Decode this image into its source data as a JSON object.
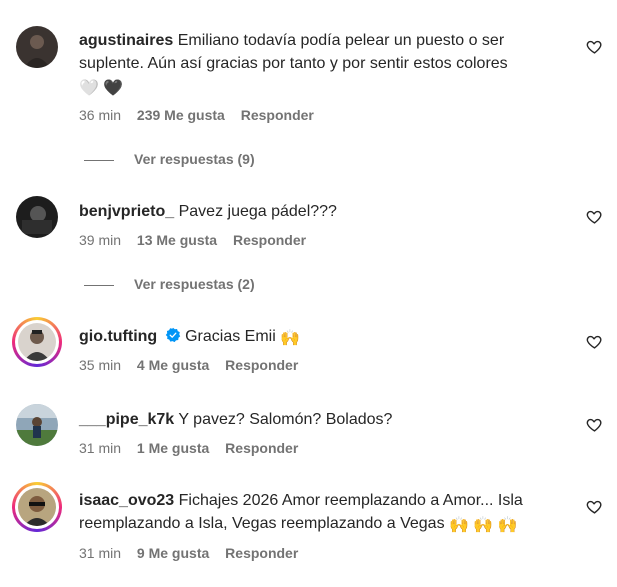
{
  "comments": [
    {
      "username": "agustinaires",
      "text": "Emiliano todavía podía pelear un puesto o ser suplente. Aún así gracias por tanto y por sentir estos colores",
      "emojis": "🤍 🖤",
      "time": "36 min",
      "likes": "239 Me gusta",
      "reply": "Responder",
      "replies": "Ver respuestas (9)"
    },
    {
      "username": "benjvprieto_",
      "text": "Pavez juega pádel???",
      "time": "39 min",
      "likes": "13 Me gusta",
      "reply": "Responder",
      "replies": "Ver respuestas (2)"
    },
    {
      "username": "gio.tufting",
      "text": "Gracias Emii",
      "emojis": "🙌",
      "time": "35 min",
      "likes": "4 Me gusta",
      "reply": "Responder"
    },
    {
      "username": "___pipe_k7k",
      "text": "Y pavez? Salomón? Bolados?",
      "time": "31 min",
      "likes": "1 Me gusta",
      "reply": "Responder"
    },
    {
      "username": "isaac_ovo23",
      "text": "Fichajes 2026 Amor reemplazando a Amor... Isla reemplazando a Isla, Vegas reemplazando a Vegas",
      "emojis": "🙌 🙌 🙌",
      "time": "31 min",
      "likes": "9 Me gusta",
      "reply": "Responder"
    }
  ]
}
